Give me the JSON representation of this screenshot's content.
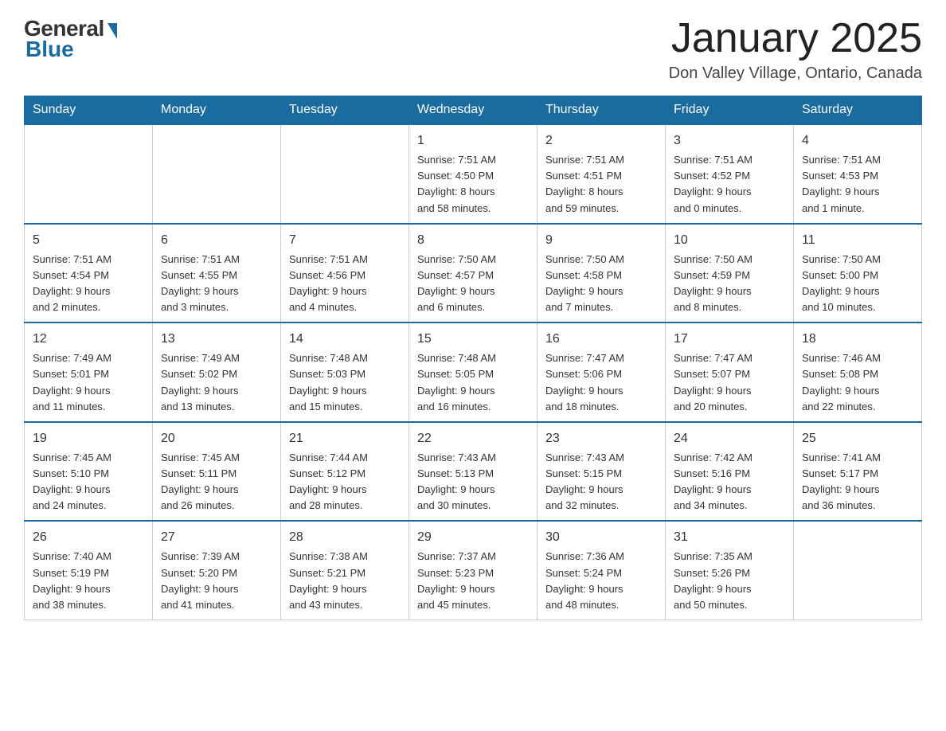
{
  "header": {
    "title": "January 2025",
    "location": "Don Valley Village, Ontario, Canada"
  },
  "logo": {
    "general": "General",
    "blue": "Blue"
  },
  "days_of_week": [
    "Sunday",
    "Monday",
    "Tuesday",
    "Wednesday",
    "Thursday",
    "Friday",
    "Saturday"
  ],
  "weeks": [
    {
      "days": [
        {
          "number": "",
          "info": ""
        },
        {
          "number": "",
          "info": ""
        },
        {
          "number": "",
          "info": ""
        },
        {
          "number": "1",
          "info": "Sunrise: 7:51 AM\nSunset: 4:50 PM\nDaylight: 8 hours\nand 58 minutes."
        },
        {
          "number": "2",
          "info": "Sunrise: 7:51 AM\nSunset: 4:51 PM\nDaylight: 8 hours\nand 59 minutes."
        },
        {
          "number": "3",
          "info": "Sunrise: 7:51 AM\nSunset: 4:52 PM\nDaylight: 9 hours\nand 0 minutes."
        },
        {
          "number": "4",
          "info": "Sunrise: 7:51 AM\nSunset: 4:53 PM\nDaylight: 9 hours\nand 1 minute."
        }
      ]
    },
    {
      "days": [
        {
          "number": "5",
          "info": "Sunrise: 7:51 AM\nSunset: 4:54 PM\nDaylight: 9 hours\nand 2 minutes."
        },
        {
          "number": "6",
          "info": "Sunrise: 7:51 AM\nSunset: 4:55 PM\nDaylight: 9 hours\nand 3 minutes."
        },
        {
          "number": "7",
          "info": "Sunrise: 7:51 AM\nSunset: 4:56 PM\nDaylight: 9 hours\nand 4 minutes."
        },
        {
          "number": "8",
          "info": "Sunrise: 7:50 AM\nSunset: 4:57 PM\nDaylight: 9 hours\nand 6 minutes."
        },
        {
          "number": "9",
          "info": "Sunrise: 7:50 AM\nSunset: 4:58 PM\nDaylight: 9 hours\nand 7 minutes."
        },
        {
          "number": "10",
          "info": "Sunrise: 7:50 AM\nSunset: 4:59 PM\nDaylight: 9 hours\nand 8 minutes."
        },
        {
          "number": "11",
          "info": "Sunrise: 7:50 AM\nSunset: 5:00 PM\nDaylight: 9 hours\nand 10 minutes."
        }
      ]
    },
    {
      "days": [
        {
          "number": "12",
          "info": "Sunrise: 7:49 AM\nSunset: 5:01 PM\nDaylight: 9 hours\nand 11 minutes."
        },
        {
          "number": "13",
          "info": "Sunrise: 7:49 AM\nSunset: 5:02 PM\nDaylight: 9 hours\nand 13 minutes."
        },
        {
          "number": "14",
          "info": "Sunrise: 7:48 AM\nSunset: 5:03 PM\nDaylight: 9 hours\nand 15 minutes."
        },
        {
          "number": "15",
          "info": "Sunrise: 7:48 AM\nSunset: 5:05 PM\nDaylight: 9 hours\nand 16 minutes."
        },
        {
          "number": "16",
          "info": "Sunrise: 7:47 AM\nSunset: 5:06 PM\nDaylight: 9 hours\nand 18 minutes."
        },
        {
          "number": "17",
          "info": "Sunrise: 7:47 AM\nSunset: 5:07 PM\nDaylight: 9 hours\nand 20 minutes."
        },
        {
          "number": "18",
          "info": "Sunrise: 7:46 AM\nSunset: 5:08 PM\nDaylight: 9 hours\nand 22 minutes."
        }
      ]
    },
    {
      "days": [
        {
          "number": "19",
          "info": "Sunrise: 7:45 AM\nSunset: 5:10 PM\nDaylight: 9 hours\nand 24 minutes."
        },
        {
          "number": "20",
          "info": "Sunrise: 7:45 AM\nSunset: 5:11 PM\nDaylight: 9 hours\nand 26 minutes."
        },
        {
          "number": "21",
          "info": "Sunrise: 7:44 AM\nSunset: 5:12 PM\nDaylight: 9 hours\nand 28 minutes."
        },
        {
          "number": "22",
          "info": "Sunrise: 7:43 AM\nSunset: 5:13 PM\nDaylight: 9 hours\nand 30 minutes."
        },
        {
          "number": "23",
          "info": "Sunrise: 7:43 AM\nSunset: 5:15 PM\nDaylight: 9 hours\nand 32 minutes."
        },
        {
          "number": "24",
          "info": "Sunrise: 7:42 AM\nSunset: 5:16 PM\nDaylight: 9 hours\nand 34 minutes."
        },
        {
          "number": "25",
          "info": "Sunrise: 7:41 AM\nSunset: 5:17 PM\nDaylight: 9 hours\nand 36 minutes."
        }
      ]
    },
    {
      "days": [
        {
          "number": "26",
          "info": "Sunrise: 7:40 AM\nSunset: 5:19 PM\nDaylight: 9 hours\nand 38 minutes."
        },
        {
          "number": "27",
          "info": "Sunrise: 7:39 AM\nSunset: 5:20 PM\nDaylight: 9 hours\nand 41 minutes."
        },
        {
          "number": "28",
          "info": "Sunrise: 7:38 AM\nSunset: 5:21 PM\nDaylight: 9 hours\nand 43 minutes."
        },
        {
          "number": "29",
          "info": "Sunrise: 7:37 AM\nSunset: 5:23 PM\nDaylight: 9 hours\nand 45 minutes."
        },
        {
          "number": "30",
          "info": "Sunrise: 7:36 AM\nSunset: 5:24 PM\nDaylight: 9 hours\nand 48 minutes."
        },
        {
          "number": "31",
          "info": "Sunrise: 7:35 AM\nSunset: 5:26 PM\nDaylight: 9 hours\nand 50 minutes."
        },
        {
          "number": "",
          "info": ""
        }
      ]
    }
  ]
}
